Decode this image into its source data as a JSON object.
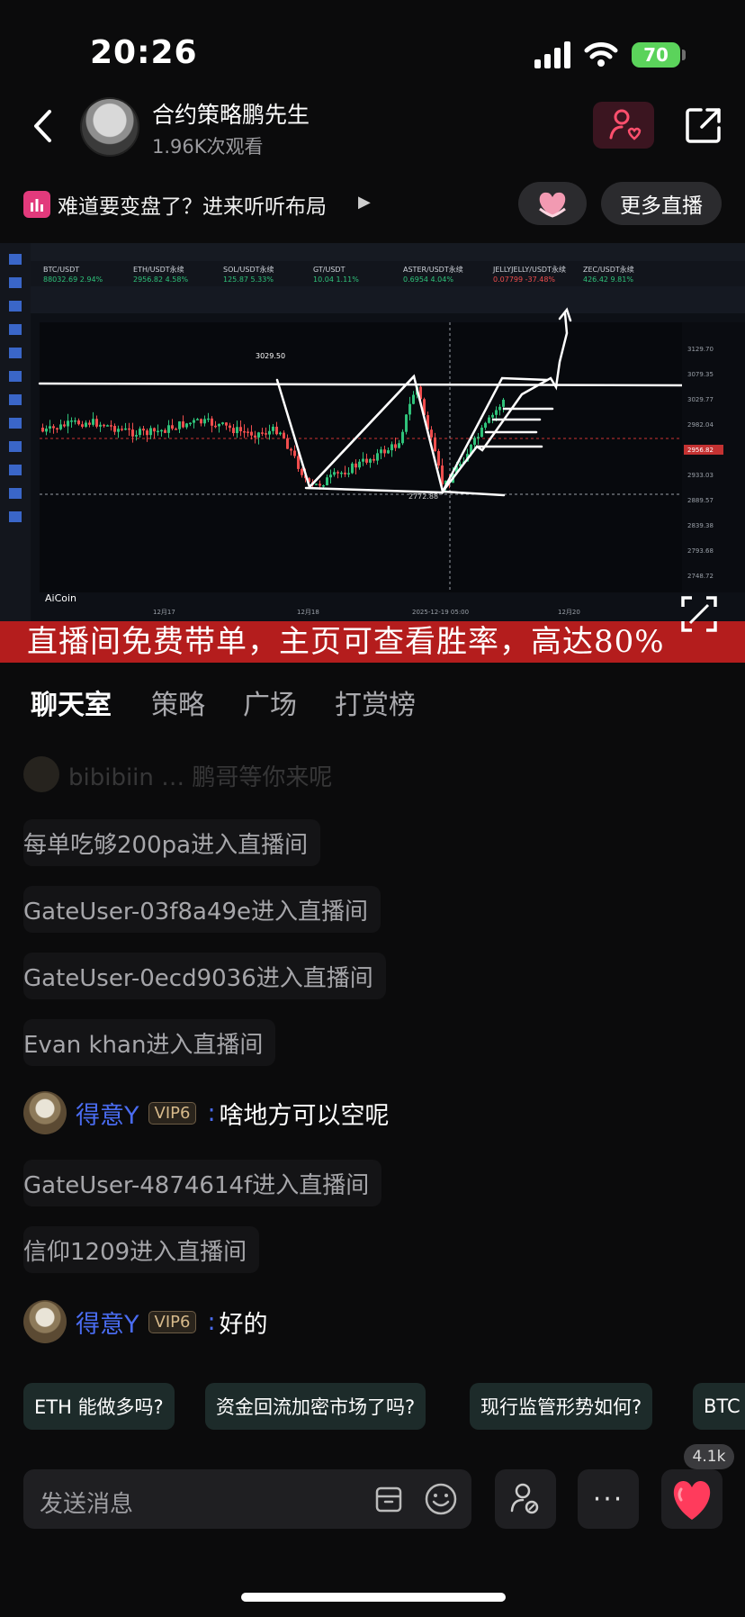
{
  "status_bar": {
    "time": "20:26",
    "battery": "70"
  },
  "header": {
    "host_name": "合约策略鹏先生",
    "viewers": "1.96K次观看"
  },
  "notice": {
    "text": "难道要变盘了？进来听听布局",
    "more_live": "更多直播"
  },
  "video": {
    "banner": "直播间免费带单，主页可查看胜率，高达80%",
    "tickers": [
      {
        "pair": "BTC/USDT",
        "value": "88032.69 2.94%"
      },
      {
        "pair": "ETH/USDT永续",
        "value": "2956.82 4.58%"
      },
      {
        "pair": "SOL/USDT永续",
        "value": "125.87 5.33%"
      },
      {
        "pair": "GT/USDT",
        "value": "10.04 1.11%"
      },
      {
        "pair": "ASTER/USDT永续",
        "value": "0.6954 4.04%"
      },
      {
        "pair": "JELLYJELLY/USDT永续",
        "value": "0.07799 -37.48%"
      },
      {
        "pair": "ZEC/USDT永续",
        "value": "426.42 9.81%"
      }
    ],
    "price_labels": [
      "3129.70",
      "3079.35",
      "3029.77",
      "2982.04",
      "2956.82",
      "2933.03",
      "2889.57",
      "2839.38",
      "2793.68",
      "2748.72"
    ],
    "annotations": {
      "high": "3029.50",
      "low": "2772.88",
      "brand": "AiCoin"
    },
    "dates": [
      "12月17",
      "12月18",
      "2025-12-19 05:00",
      "12月20"
    ]
  },
  "tabs": [
    "聊天室",
    "策略",
    "广场",
    "打赏榜"
  ],
  "chat": {
    "partial_top": "bibibiin … 鹏哥等你来呢",
    "messages": [
      {
        "type": "system",
        "text": "每单吃够200pa进入直播间"
      },
      {
        "type": "system",
        "text": "GateUser-03f8a49e进入直播间"
      },
      {
        "type": "system",
        "text": "GateUser-0ecd9036进入直播间"
      },
      {
        "type": "system",
        "text": "Evan khan进入直播间"
      },
      {
        "type": "user",
        "user": "得意Y",
        "vip": "VIP6",
        "text": "啥地方可以空呢"
      },
      {
        "type": "system",
        "text": "GateUser-4874614f进入直播间"
      },
      {
        "type": "system",
        "text": "信仰1209进入直播间"
      },
      {
        "type": "user",
        "user": "得意Y",
        "vip": "VIP6",
        "text": "好的"
      }
    ]
  },
  "suggestions": [
    "ETH 能做多吗?",
    "资金回流加密市场了吗?",
    "现行监管形势如何?",
    "BTC"
  ],
  "input": {
    "placeholder": "发送消息",
    "more": "···",
    "like_count": "4.1k"
  },
  "colors": {
    "accent_pink": "#e23a7c",
    "banner_red": "#b41d1d",
    "username_blue": "#4a6cf0",
    "heart_red": "#ff3b5c"
  }
}
